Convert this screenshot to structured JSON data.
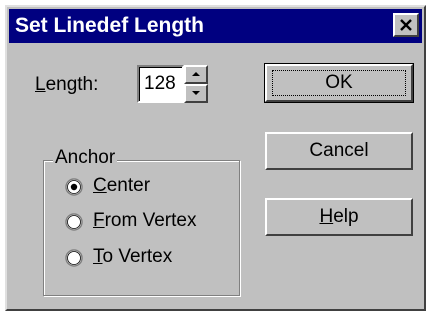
{
  "window": {
    "title": "Set Linedef Length",
    "close_glyph": "×"
  },
  "length": {
    "label_mnemonic": "L",
    "label_rest": "ength:",
    "value": "128",
    "up_icon": "spin-up-arrow",
    "down_icon": "spin-down-arrow"
  },
  "anchor": {
    "group_label": "Anchor",
    "options": [
      {
        "mnemonic": "C",
        "rest": "enter",
        "selected": true
      },
      {
        "mnemonic": "F",
        "rest": "rom Vertex",
        "selected": false
      },
      {
        "mnemonic": "T",
        "rest": "o Vertex",
        "selected": false
      }
    ]
  },
  "buttons": {
    "ok": "OK",
    "cancel": "Cancel",
    "help_mnemonic": "H",
    "help_rest": "elp"
  },
  "colors": {
    "titlebar": "#000080",
    "face": "#c0c0c0"
  }
}
